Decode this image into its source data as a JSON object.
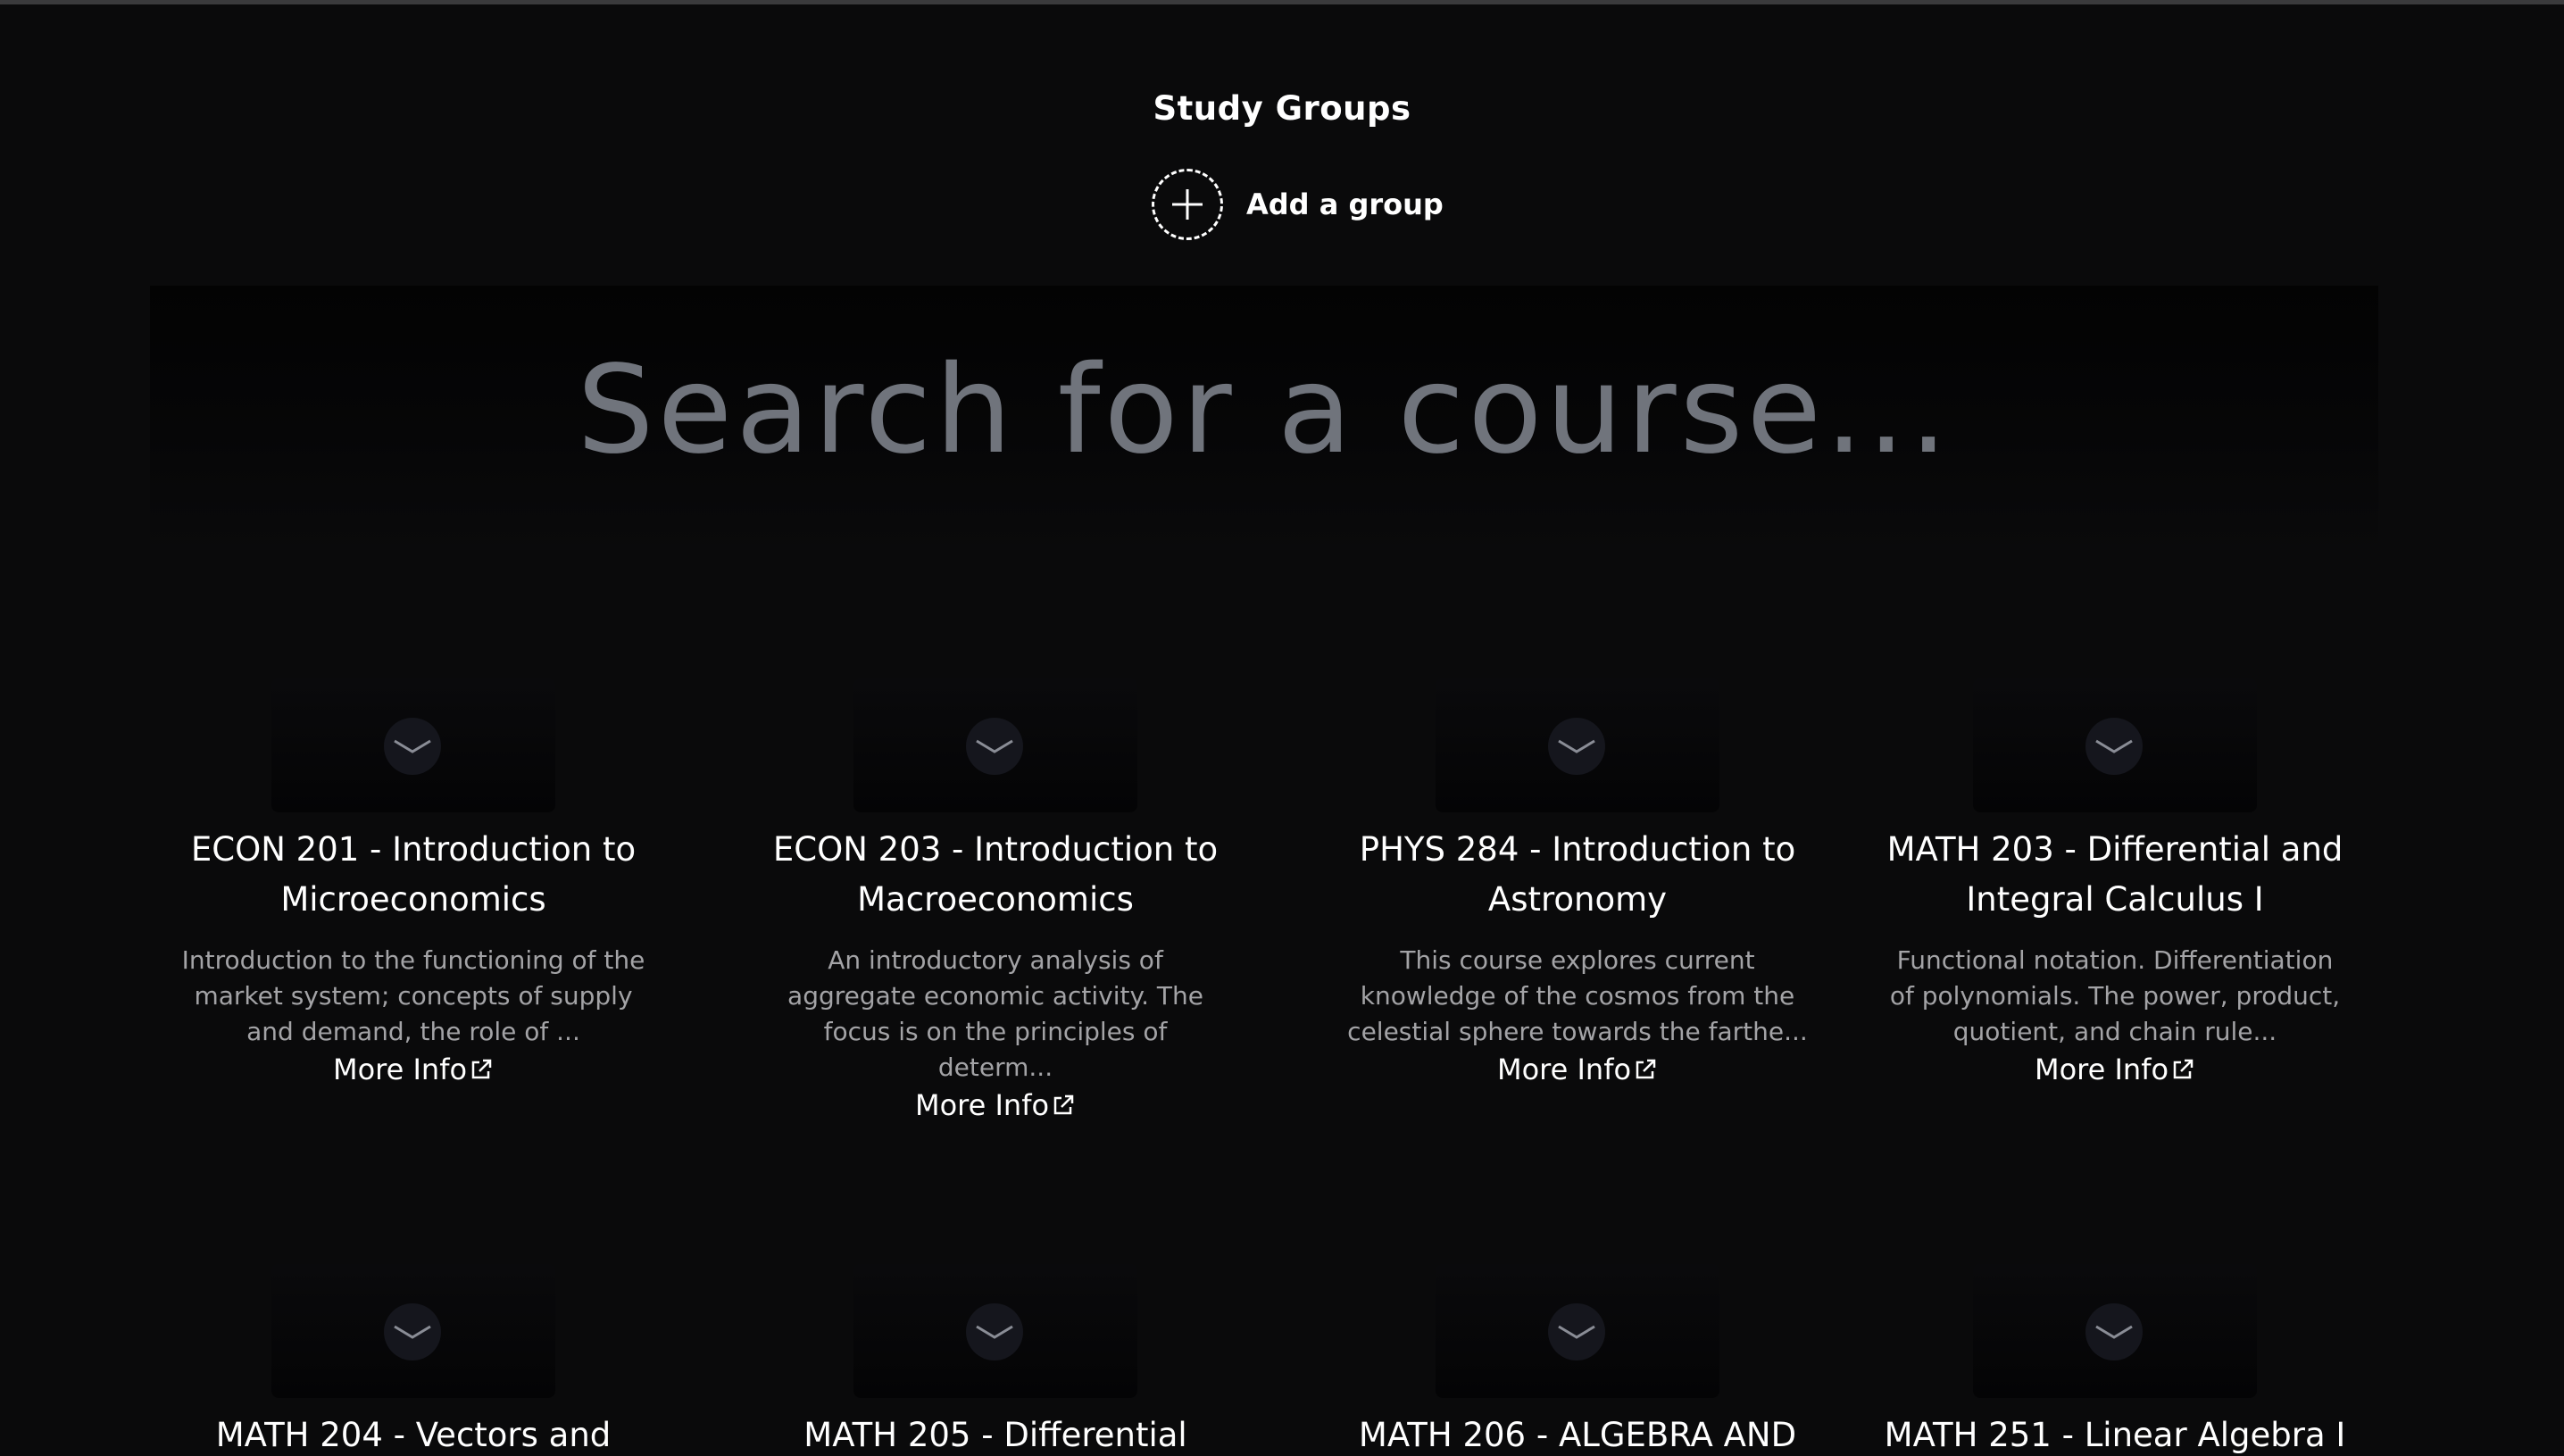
{
  "header": {
    "title": "Study Groups",
    "add_group_label": "Add a group"
  },
  "search": {
    "placeholder": "Search for a course..."
  },
  "courses": [
    {
      "title": "ECON 201 - Introduction to Microeconomics",
      "description": "Introduction to the functioning of the market system; concepts of supply and demand, the role of ...",
      "more_info": "More Info"
    },
    {
      "title": "ECON 203 - Introduction to Macroeconomics",
      "description": "An introductory analysis of aggregate economic activity. The focus is on the principles of determ...",
      "more_info": "More Info"
    },
    {
      "title": "PHYS 284 - Introduction to Astronomy",
      "description": "This course explores current knowledge of the cosmos from the celestial sphere towards the farthe...",
      "more_info": "More Info"
    },
    {
      "title": "MATH 203 - Differential and Integral Calculus I",
      "description": "Functional notation. Differentiation of polynomials. The power, product, quotient, and chain rule...",
      "more_info": "More Info"
    },
    {
      "title": "MATH 204 - Vectors and",
      "description": "",
      "more_info": ""
    },
    {
      "title": "MATH 205 - Differential",
      "description": "",
      "more_info": ""
    },
    {
      "title": "MATH 206 - ALGEBRA AND",
      "description": "",
      "more_info": ""
    },
    {
      "title": "MATH 251 - Linear Algebra I",
      "description": "",
      "more_info": ""
    }
  ],
  "icons": {
    "add": "plus-icon",
    "thumbnail": "chevron-down-icon",
    "external": "external-link-icon"
  },
  "colors": {
    "background": "#0a0a0b",
    "text": "#ffffff",
    "muted_text": "#a3a3a6",
    "placeholder": "#70747c"
  }
}
